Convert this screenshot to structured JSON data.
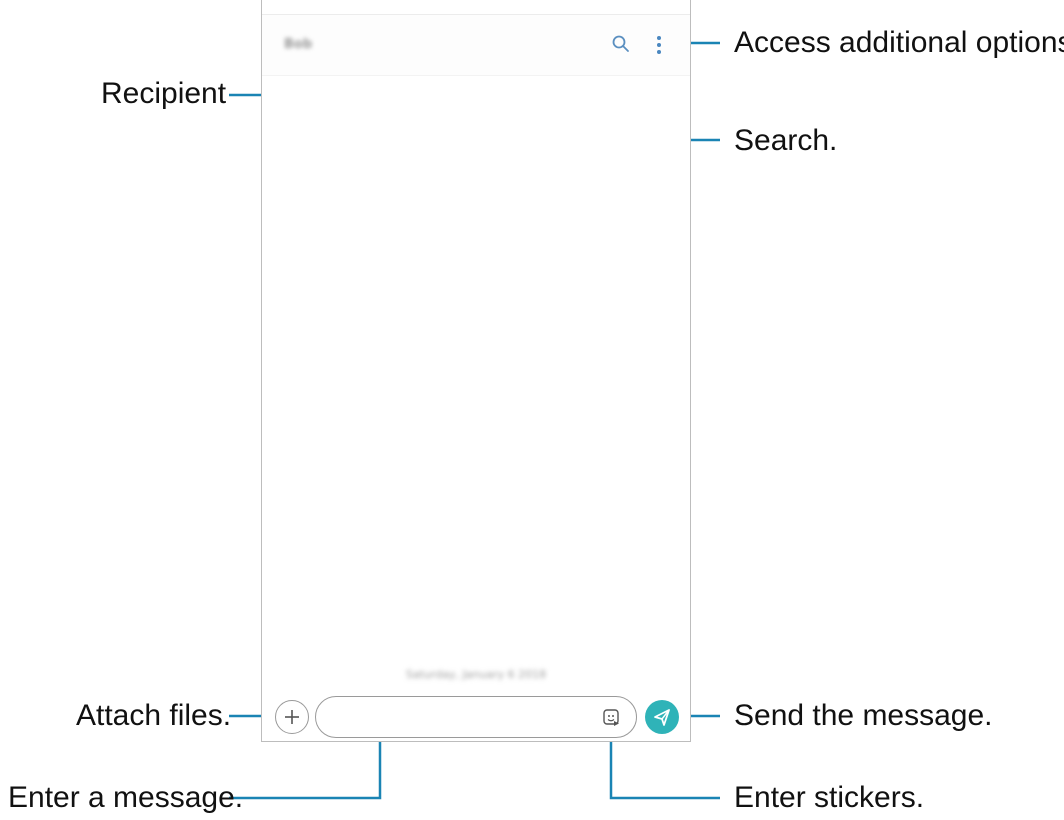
{
  "conversation": {
    "recipient_name": "Bob",
    "date_separator": "Saturday, January 6 2018",
    "message_placeholder": "",
    "accent_color": "#2fb3b8",
    "icons": {
      "search": "search-icon",
      "more": "more-vertical-icon",
      "attach": "plus-icon",
      "sticker": "sticker-icon",
      "send": "send-icon"
    }
  },
  "callouts": {
    "recipient": "Recipient",
    "options": "Access additional options.",
    "search": "Search.",
    "attach": "Attach files.",
    "send": "Send the message.",
    "enter_message": "Enter a message.",
    "stickers": "Enter stickers."
  }
}
